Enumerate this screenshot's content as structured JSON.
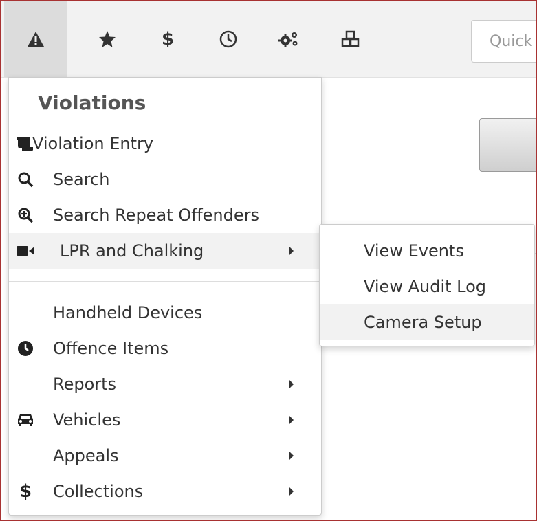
{
  "toolbar": {
    "icons": [
      "warning-icon",
      "star-icon",
      "dollar-icon",
      "clock-icon",
      "cogs-icon",
      "cubes-icon"
    ],
    "dollar_glyph": "$",
    "quick_search_placeholder": "Quick"
  },
  "menu": {
    "header": "Violations",
    "items": [
      {
        "label": "Violation Entry",
        "icon": "scroll-icon"
      },
      {
        "label": "Search",
        "icon": "search-icon"
      },
      {
        "label": "Search Repeat Offenders",
        "icon": "search-plus-icon"
      },
      {
        "label": "LPR and Chalking",
        "icon": "video-camera-icon",
        "has_submenu": true,
        "highlighted": true
      },
      {
        "label": "Handheld Devices"
      },
      {
        "label": "Offence Items",
        "icon": "clock-icon"
      },
      {
        "label": "Reports",
        "has_submenu": true
      },
      {
        "label": "Vehicles",
        "icon": "car-icon",
        "has_submenu": true
      },
      {
        "label": "Appeals",
        "has_submenu": true
      },
      {
        "label": "Collections",
        "icon": "dollar-icon",
        "icon_glyph": "$",
        "has_submenu": true
      }
    ]
  },
  "submenu": {
    "items": [
      {
        "label": "View Events"
      },
      {
        "label": "View Audit Log"
      },
      {
        "label": "Camera Setup",
        "highlighted": true
      }
    ]
  },
  "colors": {
    "frame_border": "#a83232",
    "toolbar_bg": "#f2f2f2",
    "active_tab_bg": "#dcdcdc",
    "hover_bg": "#f2f2f2",
    "text": "#333333",
    "header_text": "#555555"
  }
}
